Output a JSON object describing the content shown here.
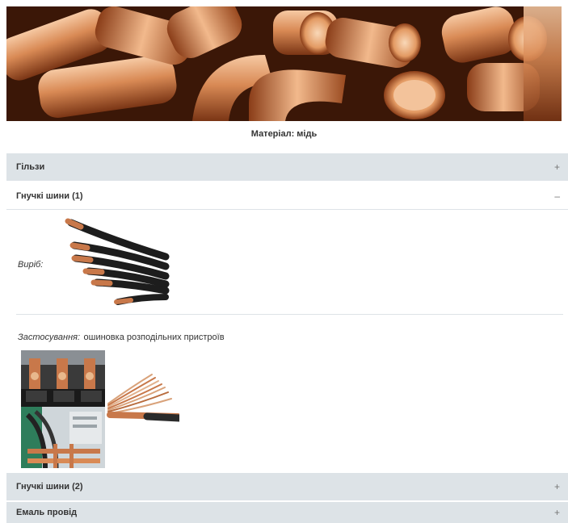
{
  "hero": {
    "image": "copper-fittings-photo"
  },
  "material_title": "Матеріал: мідь",
  "accordion": [
    {
      "label": "Гільзи",
      "state": "closed",
      "sign": "+"
    },
    {
      "label": "Гнучкі шини (1)",
      "state": "open",
      "sign": "–"
    },
    {
      "label": "Гнучкі шини (2)",
      "state": "closed",
      "sign": "+"
    },
    {
      "label": "Емаль провід",
      "state": "closed",
      "sign": "+"
    }
  ],
  "panel": {
    "product_label": "Виріб:",
    "usage_label": "Застосування:",
    "usage_value": "ошиновка розподільних пристроїв",
    "product_image": "flexible-busbars-photo",
    "usage_images": [
      "switchgear-busbars-photo",
      "busbar-panel-photo",
      "flexible-busbar-closeup-photo"
    ]
  },
  "colors": {
    "accordion_bg": "#dde3e7",
    "copper": "#c8784a"
  }
}
